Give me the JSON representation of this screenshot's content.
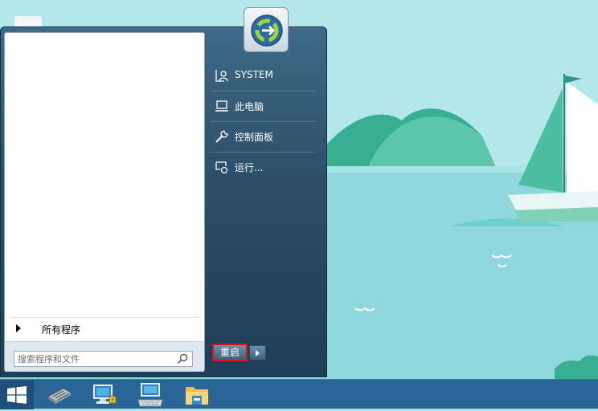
{
  "start_menu": {
    "left_pane": {
      "all_programs_label": "所有程序",
      "search_placeholder": "搜索程序和文件"
    },
    "right_pane": {
      "items": [
        {
          "label": "SYSTEM",
          "icon": "user-folder-icon"
        },
        {
          "label": "此电脑",
          "icon": "computer-icon"
        },
        {
          "label": "控制面板",
          "icon": "wrench-icon"
        },
        {
          "label": "运行...",
          "icon": "run-icon"
        }
      ],
      "restart_label": "重启"
    }
  },
  "taskbar": {
    "start_icon": "windows-logo-icon",
    "items": [
      {
        "icon": "memory-chip-icon"
      },
      {
        "icon": "network-computer-icon"
      },
      {
        "icon": "keyboard-computer-icon"
      },
      {
        "icon": "file-explorer-icon"
      }
    ]
  },
  "colors": {
    "taskbar": "#2a6597",
    "menu_right": "#2b4e68",
    "highlight_border": "#e0101a"
  }
}
